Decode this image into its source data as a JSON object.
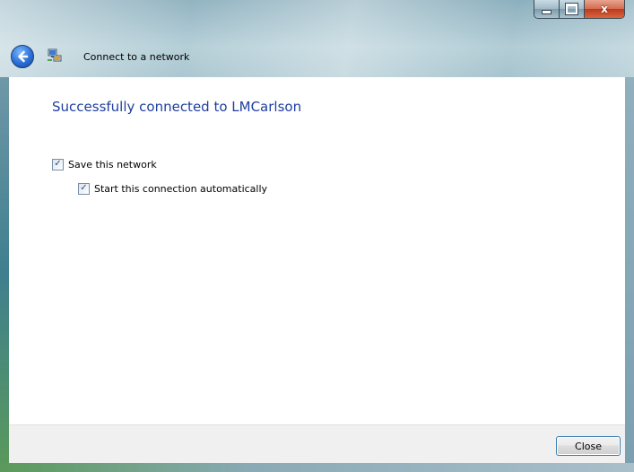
{
  "window": {
    "caption_buttons": {
      "minimize_icon": "minimize-icon",
      "maximize_icon": "maximize-icon",
      "close_glyph": "x"
    }
  },
  "nav": {
    "back_icon": "back-arrow-icon",
    "app_icon": "network-icon",
    "title": "Connect to a network"
  },
  "content": {
    "heading": "Successfully connected to LMCarlson",
    "options": [
      {
        "label": "Save this network",
        "checked": true
      },
      {
        "label": "Start this connection automatically",
        "checked": true
      }
    ]
  },
  "footer": {
    "close_label": "Close"
  },
  "colors": {
    "heading": "#1e3fa0",
    "footer_bg": "#f0f0f0",
    "button_border": "#3c7fb1"
  }
}
